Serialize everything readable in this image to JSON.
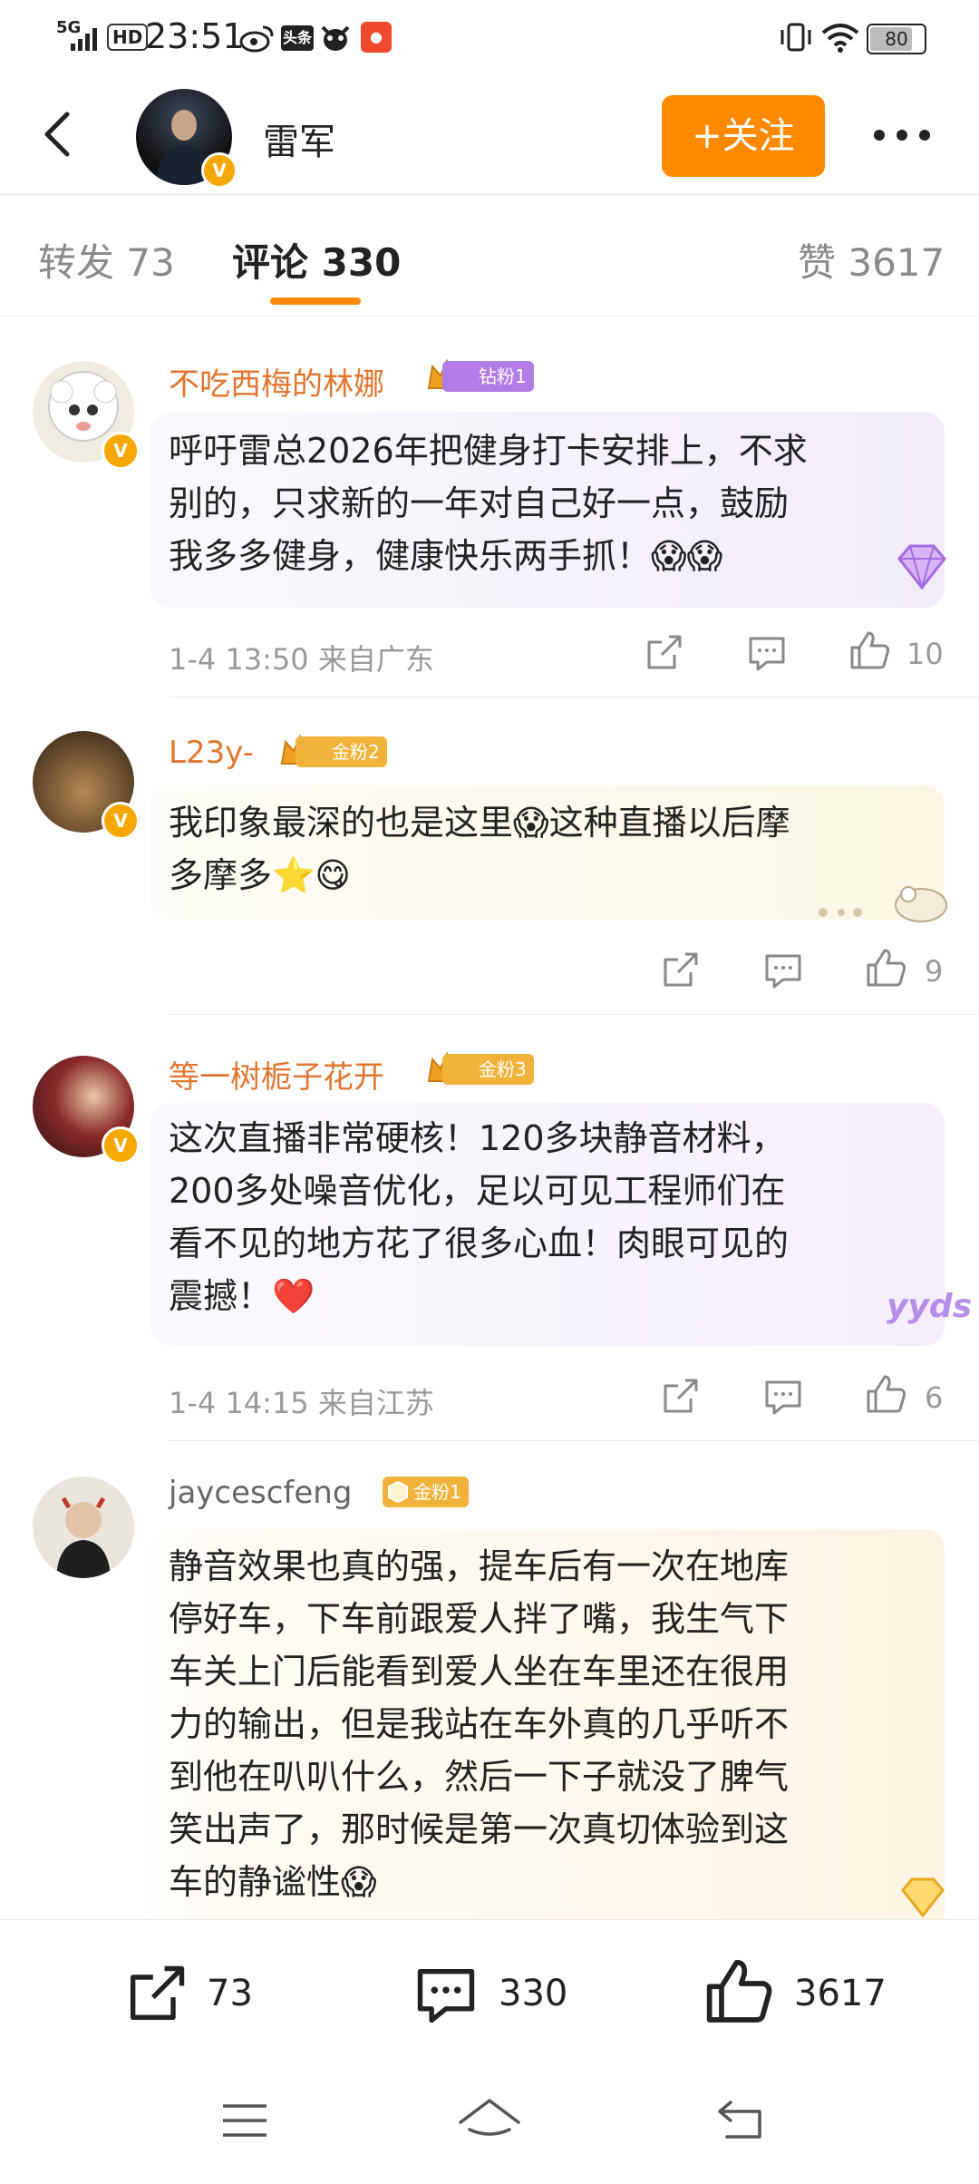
{
  "status_bar": {
    "network": "5G",
    "hd": "HD",
    "time": "23:51",
    "app_icons": [
      "weibo-icon",
      "toutiao-icon",
      "cow-icon",
      "app-icon"
    ],
    "battery": "80"
  },
  "header": {
    "user_name": "雷军",
    "follow_label": "+关注"
  },
  "tabs": [
    {
      "label": "转发 73"
    },
    {
      "label": "评论 330"
    },
    {
      "label": "赞 3617"
    }
  ],
  "comments": [
    {
      "user": "不吃西梅的林娜",
      "fan_badge": "钻粉1",
      "text_lines": [
        "呼吁雷总2026年把健身打卡安排上，不求",
        "别的，只求新的一年对自己好一点，鼓励",
        "我多多健身，健康快乐两手抓！😱😱"
      ],
      "meta": "1-4 13:50  来自广东",
      "likes": "10"
    },
    {
      "user": "L23y-",
      "fan_badge": "金粉2",
      "text_lines": [
        "我印象最深的也是这里😱这种直播以后摩",
        "多摩多⭐😋"
      ],
      "meta": "",
      "likes": "9"
    },
    {
      "user": "等一树栀子花开",
      "fan_badge": "金粉3",
      "text_lines": [
        "这次直播非常硬核！120多块静音材料，",
        "200多处噪音优化，足以可见工程师们在",
        "看不见的地方花了很多心血！肉眼可见的",
        "震撼！❤️"
      ],
      "meta": "1-4 14:15  来自江苏",
      "likes": "6",
      "sticker": "yyds"
    },
    {
      "user": "jaycescfeng",
      "fan_badge": "金粉1",
      "text_lines": [
        "静音效果也真的强，提车后有一次在地库",
        "停好车，下车前跟爱人拌了嘴，我生气下",
        "车关上门后能看到爱人坐在车里还在很用",
        "力的输出，但是我站在车外真的几乎听不",
        "到他在叭叭什么，然后一下子就没了脾气",
        "笑出声了，那时候是第一次真切体验到这",
        "车的静谧性😱"
      ]
    }
  ],
  "bottom_bar": {
    "repost_count": "73",
    "comment_count": "330",
    "like_count": "3617"
  },
  "colors": {
    "accent": "#ff8a00",
    "username": "#e0762f",
    "verified": "#f6a700"
  }
}
